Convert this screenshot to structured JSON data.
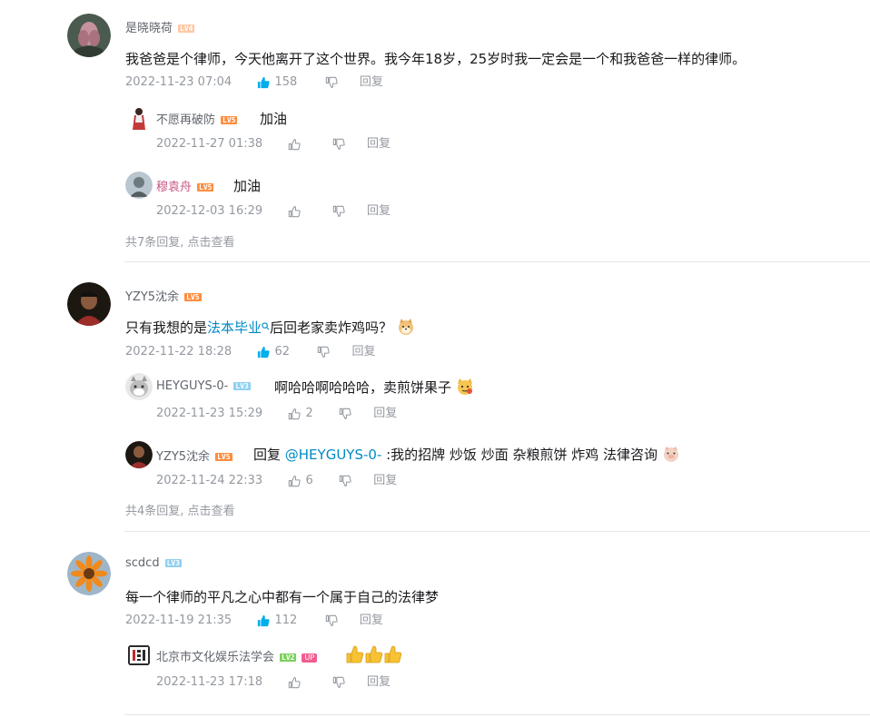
{
  "comments": [
    {
      "user": "是晓晓荷",
      "level": "LV4",
      "text": "我爸爸是个律师，今天他离开了这个世界。我今年18岁，25岁时我一定会是一个和我爸爸一样的律师。",
      "date": "2022-11-23 07:04",
      "likes": "158",
      "reply": "回复",
      "replies": [
        {
          "user": "不愿再破防",
          "level": "LV5",
          "text": "加油",
          "date": "2022-11-27 01:38",
          "likes": "",
          "reply": "回复"
        },
        {
          "user": "穆袁舟",
          "level": "LV5",
          "text": "加油",
          "date": "2022-12-03 16:29",
          "likes": "",
          "reply": "回复"
        }
      ],
      "more": "共7条回复, 点击查看"
    },
    {
      "user": "YZY5沈余",
      "level": "LV5",
      "text_before": "只有我想的是",
      "text_link": "法本毕业",
      "text_after": "后回老家卖炸鸡吗？",
      "date": "2022-11-22 18:28",
      "likes": "62",
      "reply": "回复",
      "replies": [
        {
          "user": "HEYGUYS-0-",
          "level": "LV3",
          "text": "啊哈哈啊哈哈哈，卖煎饼果子",
          "date": "2022-11-23 15:29",
          "likes": "2",
          "reply": "回复"
        },
        {
          "user": "YZY5沈余",
          "level": "LV5",
          "text_prefix": "回复 ",
          "text_at": "@HEYGUYS-0-",
          "text_after": " :我的招牌 炒饭  炒面 杂粮煎饼 炸鸡 法律咨询",
          "date": "2022-11-24 22:33",
          "likes": "6",
          "reply": "回复"
        }
      ],
      "more": "共4条回复, 点击查看"
    },
    {
      "user": "scdcd",
      "level": "LV3",
      "text": "每一个律师的平凡之心中都有一个属于自己的法律梦",
      "date": "2022-11-19 21:35",
      "likes": "112",
      "reply": "回复",
      "replies": [
        {
          "user": "北京市文化娱乐法学会",
          "level": "LV2",
          "badge": "UP",
          "text": "👍👍👍",
          "date": "2022-11-23 17:18",
          "likes": "",
          "reply": "回复"
        }
      ]
    }
  ],
  "colors": {
    "link": "#008ac5",
    "meta": "#9499a0",
    "like_active": "#00aeec"
  }
}
